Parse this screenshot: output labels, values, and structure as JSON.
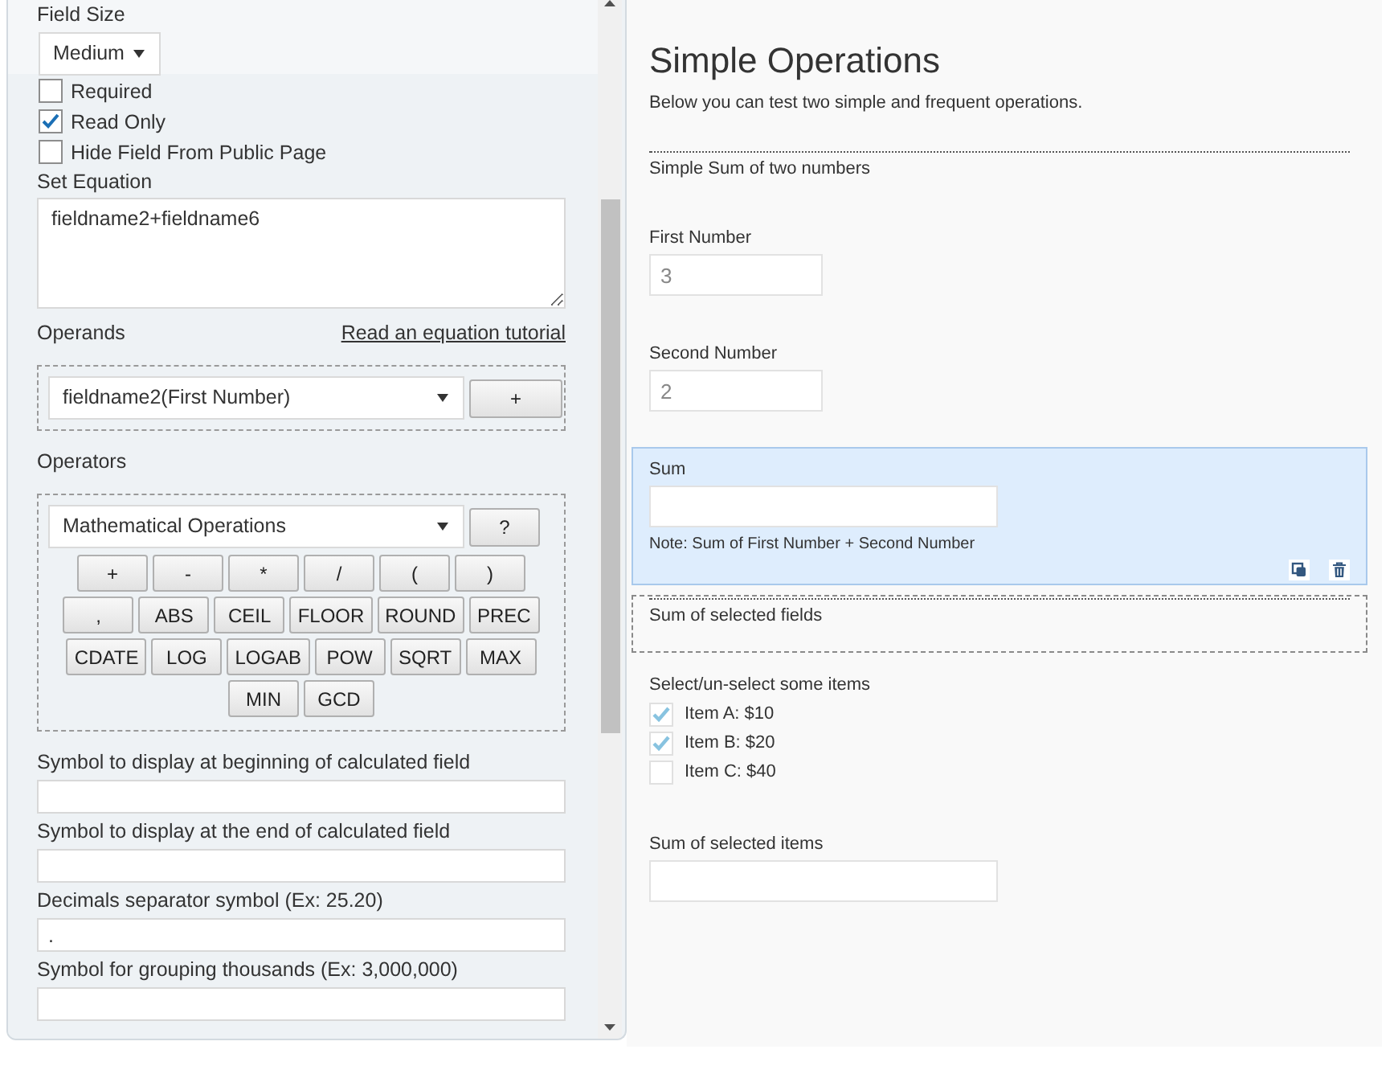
{
  "editor_panel": {
    "field_size": {
      "label": "Field Size",
      "value": "Medium"
    },
    "options": [
      {
        "label": "Required",
        "checked": false
      },
      {
        "label": "Read Only",
        "checked": true
      },
      {
        "label": "Hide Field From Public Page",
        "checked": false
      }
    ],
    "equation": {
      "label": "Set Equation",
      "value": "fieldname2+fieldname6"
    },
    "operands": {
      "label": "Operands",
      "link": "Read an equation tutorial",
      "value": "fieldname2(First Number)",
      "button": "+"
    },
    "operators": {
      "label": "Operators",
      "value": "Mathematical Operations",
      "button": "?",
      "button_rows": [
        [
          "+",
          "-",
          "*",
          "/",
          "(",
          ")"
        ],
        [
          ",",
          "ABS",
          "CEIL",
          "FLOOR",
          "ROUND",
          "PREC"
        ],
        [
          "CDATE",
          "LOG",
          "LOGAB",
          "POW",
          "SQRT",
          "MAX"
        ],
        [
          "MIN",
          "GCD"
        ]
      ]
    },
    "text_fields": [
      {
        "label": "Symbol to display at beginning of calculated field"
      },
      {
        "label": "Symbol to display at the end of calculated field"
      },
      {
        "label": "Decimals separator symbol (Ex: 25.20)",
        "value": "."
      },
      {
        "label": "Symbol for grouping thousands (Ex: 3,000,000)"
      }
    ]
  },
  "form_preview": {
    "title": "Simple Operations",
    "description": "Below you can test two simple and frequent operations.",
    "items": [
      {
        "kind": "section",
        "title": "Simple Sum of two numbers",
        "selected": false,
        "dashed_outline": false
      },
      {
        "kind": "number",
        "label": "First Number",
        "value": "3",
        "selected": false
      },
      {
        "kind": "number",
        "label": "Second Number",
        "value": "2",
        "selected": false
      },
      {
        "kind": "calculated",
        "label": "Sum",
        "note": "Note: Sum of First Number + Second Number",
        "selected": true
      },
      {
        "kind": "section",
        "title": "Sum of selected fields",
        "selected": false,
        "dashed_outline": true
      },
      {
        "kind": "checkboxes",
        "label": "Select/un-select some items",
        "selected": false,
        "options": [
          {
            "label": "Item A: $10",
            "checked": true
          },
          {
            "label": "Item B: $20",
            "checked": true
          },
          {
            "label": "Item C: $40",
            "checked": false
          }
        ]
      },
      {
        "kind": "calculated",
        "label": "Sum of selected items",
        "selected": false
      }
    ]
  }
}
